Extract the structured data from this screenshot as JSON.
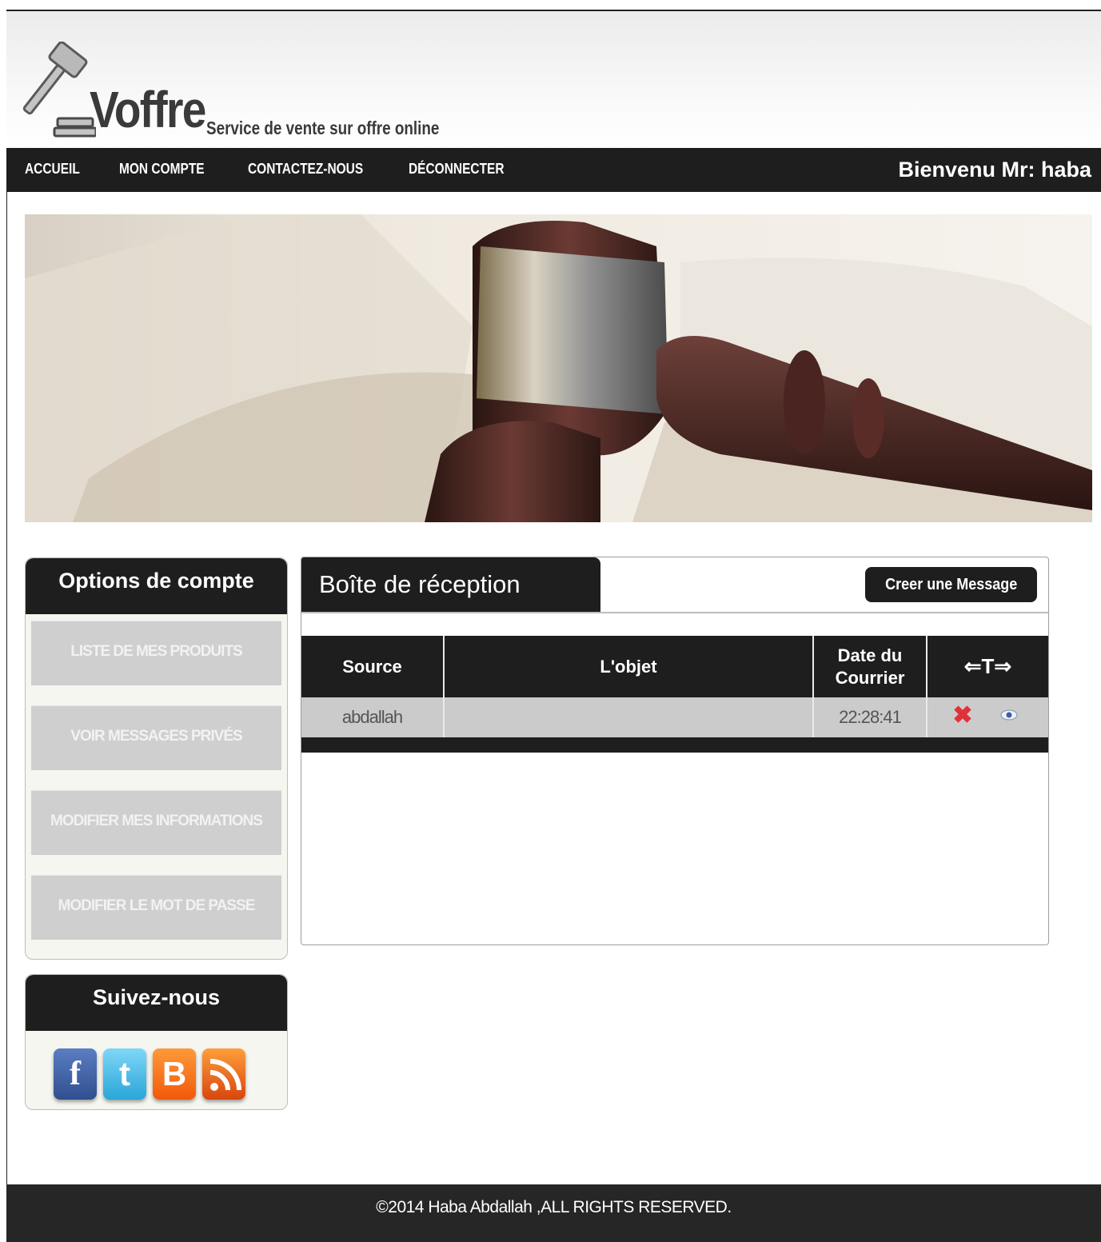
{
  "header": {
    "brand": "Voffre",
    "tagline": "Service de vente sur offre online"
  },
  "nav": {
    "items": [
      "ACCUEIL",
      "MON COMPTE",
      "CONTACTEZ-NOUS",
      "DÉCONNECTER"
    ],
    "welcome": "Bienvenu Mr: haba"
  },
  "sidebar": {
    "options_title": "Options de compte",
    "options": [
      "LISTE DE MES PRODUITS",
      "VOIR MESSAGES PRIVÉS",
      "MODIFIER MES INFORMATIONS",
      "MODIFIER LE MOT DE PASSE"
    ],
    "follow_title": "Suivez-nous",
    "social_icons": [
      "facebook-icon",
      "twitter-icon",
      "blogger-icon",
      "rss-icon"
    ]
  },
  "inbox": {
    "title": "Boîte de réception",
    "create_button": "Creer une Message",
    "columns": {
      "source": "Source",
      "object": "L'objet",
      "date_line1": "Date du",
      "date_line2": "Courrier",
      "actions": "⇐T⇒"
    },
    "rows": [
      {
        "source": "abdallah",
        "object": "",
        "date": "22:28:41"
      }
    ]
  },
  "footer": {
    "copyright": "©2014 Haba Abdallah ,ALL RIGHTS RESERVED."
  },
  "colors": {
    "dark": "#1e1e1e",
    "row_bg": "#cbcbcb",
    "sidebar_button": "#cfcfcf",
    "delete_red": "#e0313a"
  }
}
